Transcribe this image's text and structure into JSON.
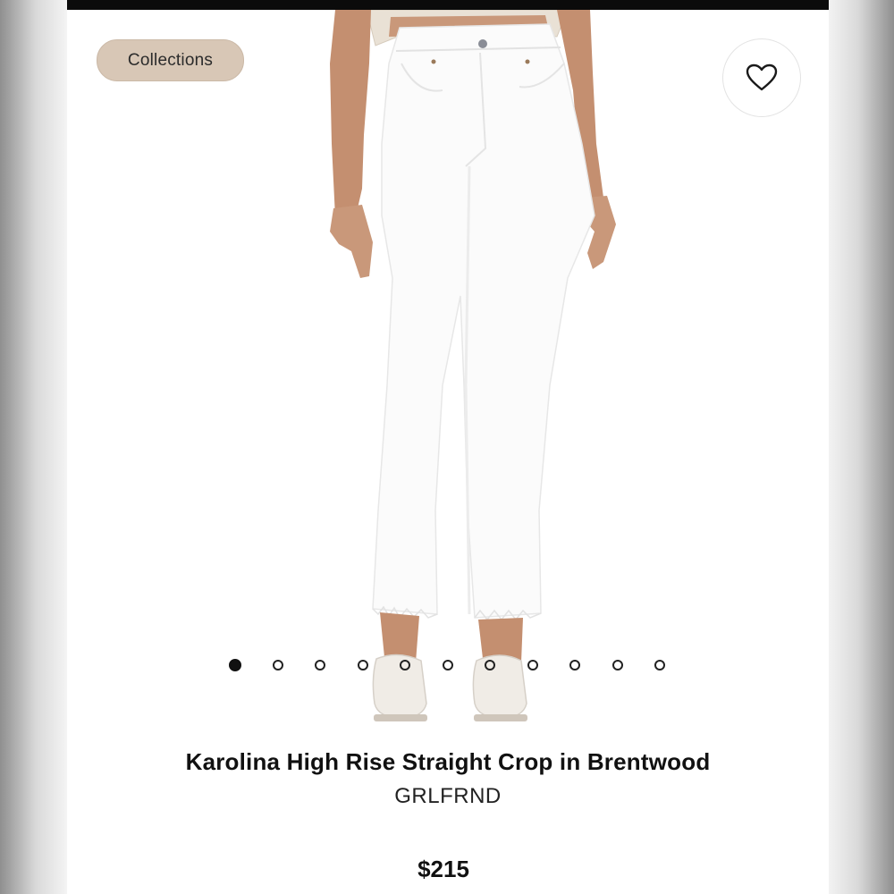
{
  "header": {
    "collections_label": "Collections",
    "favorite_icon": "heart-outline-icon"
  },
  "gallery": {
    "image_subject": "white high-rise straight crop jeans on model with white loafers",
    "total_images": 11,
    "active_index": 0
  },
  "product": {
    "title": "Karolina High Rise Straight Crop in Brentwood",
    "brand": "GRLFRND",
    "price": "$215"
  },
  "colors": {
    "chip_background": "#d8c7b6",
    "top_bar": "#0b0b0b",
    "text_primary": "#111111",
    "jeans": "#fbfbfb",
    "skin": "#c9987a"
  }
}
